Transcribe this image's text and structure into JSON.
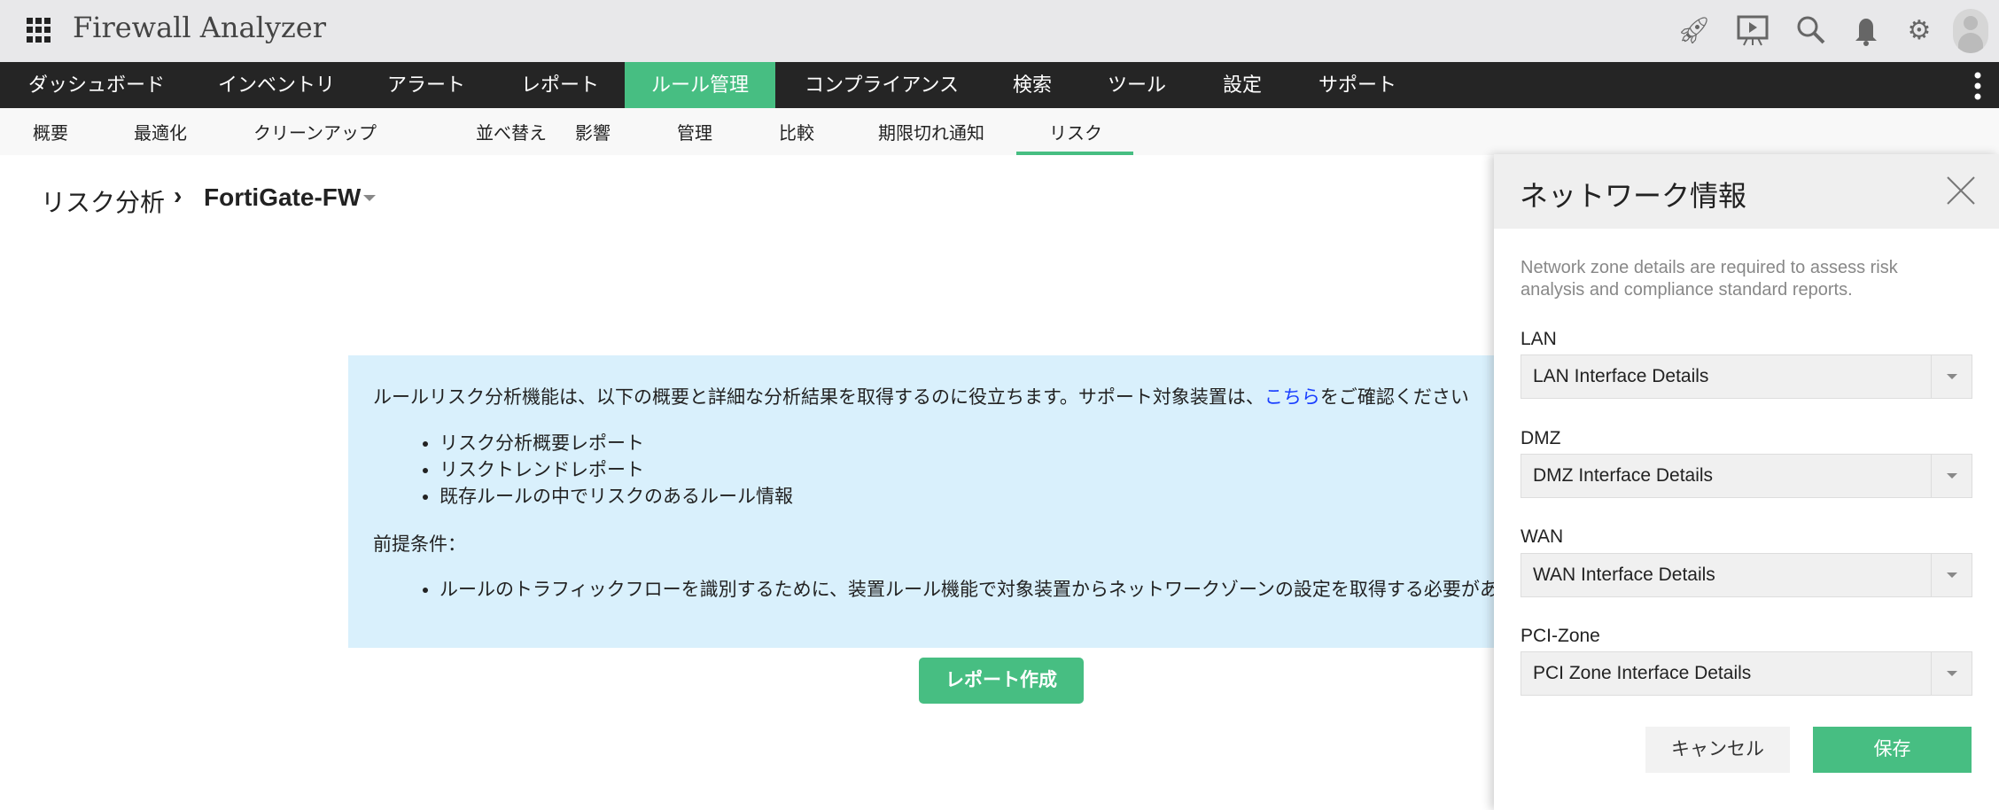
{
  "app": {
    "title": "Firewall Analyzer"
  },
  "header_icons": [
    "rocket-icon",
    "presentation-icon",
    "search-icon",
    "bell-icon",
    "gear-icon",
    "avatar-icon"
  ],
  "main_nav": [
    "ダッシュボード",
    "インベントリ",
    "アラート",
    "レポート",
    "ルール管理",
    "コンプライアンス",
    "検索",
    "ツール",
    "設定",
    "サポート"
  ],
  "main_nav_active": "ルール管理",
  "sub_nav": [
    "概要",
    "最適化",
    "クリーンアップ",
    "並べ替え",
    "影響",
    "管理",
    "比較",
    "期限切れ通知",
    "リスク"
  ],
  "sub_nav_active": "リスク",
  "breadcrumb": {
    "root": "リスク分析",
    "separator": "›",
    "device": "FortiGate-FW"
  },
  "info": {
    "intro": "ルールリスク分析機能は、以下の概要と詳細な分析結果を取得するのに役立ちます。サポート対象装置は、",
    "link": "こちら",
    "intro_end": "をご確認ください",
    "items": [
      "リスク分析概要レポート",
      "リスクトレンドレポート",
      "既存ルールの中でリスクのあるルール情報"
    ],
    "prereq_title": "前提条件：",
    "prereq_items": [
      "ルールのトラフィックフローを識別するために、装置ルール機能で対象装置からネットワークゾーンの設定を取得する必要があります"
    ]
  },
  "create_report": "レポート作成",
  "panel": {
    "title": "ネットワーク情報",
    "description": "Network zone details are required to assess risk analysis and compliance standard reports.",
    "fields": [
      {
        "label": "LAN",
        "value": "LAN Interface Details"
      },
      {
        "label": "DMZ",
        "value": "DMZ Interface Details"
      },
      {
        "label": "WAN",
        "value": "WAN Interface Details"
      },
      {
        "label": "PCI-Zone",
        "value": "PCI Zone Interface Details"
      }
    ],
    "cancel": "キャンセル",
    "save": "保存"
  },
  "colors": {
    "accent": "#47be82",
    "nav_bg": "#252525",
    "info_bg": "#d9f0fc",
    "link": "#1a3fff"
  }
}
